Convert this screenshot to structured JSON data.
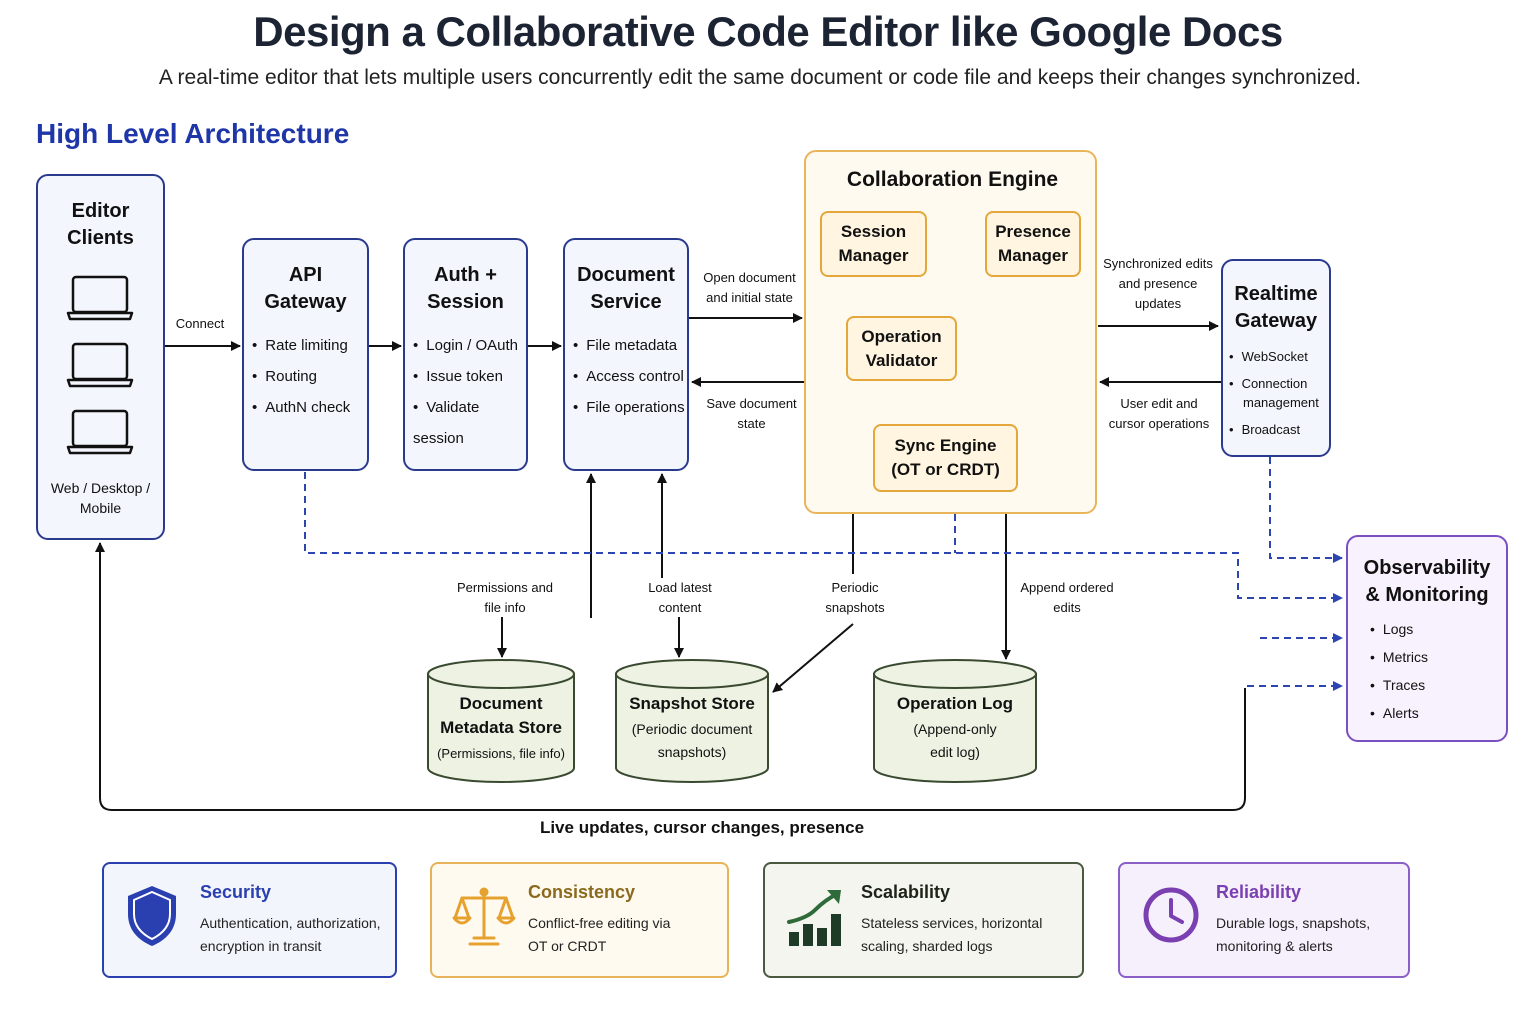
{
  "title": "Design a Collaborative Code Editor like Google Docs",
  "subtitle": "A real-time editor that lets multiple users concurrently edit the same document or code file and keeps their changes synchronized.",
  "section_title": "High Level Architecture",
  "editor_clients": {
    "title_line1": "Editor",
    "title_line2": "Clients",
    "caption_line1": "Web / Desktop /",
    "caption_line2": "Mobile"
  },
  "api_gateway": {
    "title_line1": "API",
    "title_line2": "Gateway",
    "items": [
      "Rate limiting",
      "Routing",
      "AuthN check"
    ]
  },
  "auth_session": {
    "title_line1": "Auth +",
    "title_line2": "Session",
    "items": [
      "Login / OAuth",
      "Issue token",
      "Validate session"
    ]
  },
  "document_service": {
    "title_line1": "Document",
    "title_line2": "Service",
    "items": [
      "File metadata",
      "Access control",
      "File operations"
    ]
  },
  "collaboration_engine": {
    "title": "Collaboration Engine",
    "session_manager": {
      "line1": "Session",
      "line2": "Manager"
    },
    "presence_manager": {
      "line1": "Presence",
      "line2": "Manager"
    },
    "operation_validator": {
      "line1": "Operation",
      "line2": "Validator"
    },
    "sync_engine": {
      "line1": "Sync Engine",
      "line2": "(OT or CRDT)"
    }
  },
  "realtime_gateway": {
    "title_line1": "Realtime",
    "title_line2": "Gateway",
    "items": [
      "WebSocket",
      "Connection management",
      "Broadcast"
    ]
  },
  "observability": {
    "title_line1": "Observability",
    "title_line2": "& Monitoring",
    "items": [
      "Logs",
      "Metrics",
      "Traces",
      "Alerts"
    ]
  },
  "stores": {
    "metadata": {
      "line1": "Document",
      "line2": "Metadata Store",
      "sub": "(Permissions, file info)"
    },
    "snapshot": {
      "line1": "Snapshot Store",
      "sub1": "(Periodic document",
      "sub2": "snapshots)"
    },
    "oplog": {
      "line1": "Operation Log",
      "sub1": "(Append-only",
      "sub2": "edit log)"
    }
  },
  "edge_labels": {
    "connect": "Connect",
    "open_doc_1": "Open document",
    "open_doc_2": "and initial state",
    "save_doc_1": "Save document",
    "save_doc_2": "state",
    "sync_edits_1": "Synchronized edits",
    "sync_edits_2": "and presence",
    "sync_edits_3": "updates",
    "user_edit_1": "User edit and",
    "user_edit_2": "cursor operations",
    "perm_1": "Permissions and",
    "perm_2": "file info",
    "load_1": "Load latest",
    "load_2": "content",
    "periodic_1": "Periodic",
    "periodic_2": "snapshots",
    "append_1": "Append ordered",
    "append_2": "edits",
    "live_updates": "Live updates, cursor changes, presence"
  },
  "cards": [
    {
      "title": "Security",
      "desc_line1": "Authentication, authorization,",
      "desc_line2": "encryption in transit",
      "icon": "shield-icon",
      "color": "#2a3fb0"
    },
    {
      "title": "Consistency",
      "desc_line1": "Conflict-free editing via",
      "desc_line2": "OT or CRDT",
      "icon": "scales-icon",
      "color": "#e6a12e"
    },
    {
      "title": "Scalability",
      "desc_line1": "Stateless services, horizontal",
      "desc_line2": "scaling, sharded logs",
      "icon": "growth-chart-icon",
      "color": "#2f6b3a"
    },
    {
      "title": "Reliability",
      "desc_line1": "Durable logs, snapshots,",
      "desc_line2": "monitoring & alerts",
      "icon": "clock-icon",
      "color": "#7a3fb0"
    }
  ]
}
